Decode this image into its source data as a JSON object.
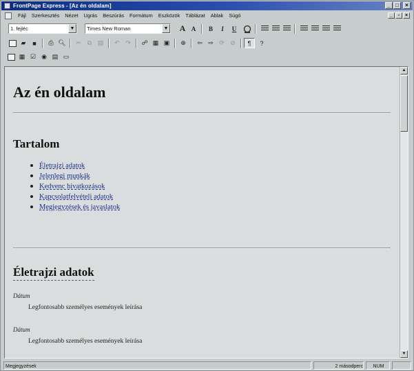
{
  "window": {
    "title": "FrontPage Express - [Az én oldalam]"
  },
  "menu": [
    "Fájl",
    "Szerkesztés",
    "Nézet",
    "Ugrás",
    "Beszúrás",
    "Formátum",
    "Eszközök",
    "Táblázat",
    "Ablak",
    "Súgó"
  ],
  "format_toolbar": {
    "style_value": "1. fejléc",
    "font_value": "Times New Roman",
    "grow_font": "A",
    "shrink_font": "A",
    "bold": "B",
    "italic": "I",
    "underline": "U"
  },
  "standard_toolbar": {
    "show_formatting": "¶",
    "help": "?"
  },
  "document": {
    "heading": "Az én oldalam",
    "toc_heading": "Tartalom",
    "toc_links": [
      "Életrajzi adatok",
      "Jelenlegi munkák",
      "Kedvenc hivatkozások",
      "Kapcsolatfelvételi adatok",
      "Megjegyzések és javaslatok"
    ],
    "bio_heading": "Életrajzi adatok",
    "entries": [
      {
        "term": "Dátum",
        "desc": "Legfontosabb személyes események leírása"
      },
      {
        "term": "Dátum",
        "desc": "Legfontosabb személyes események leírása"
      }
    ]
  },
  "status": {
    "message": "Megjegyzések",
    "time": "2 másodperc",
    "num": "NUM"
  },
  "colors": {
    "title_bar": "#0b2b86",
    "link": "#1d2f8a",
    "chrome": "#c7cdcc"
  },
  "icons": [
    "new-page-icon",
    "open-icon",
    "save-icon",
    "print-icon",
    "print-preview-icon",
    "cut-icon",
    "copy-icon",
    "paste-icon",
    "undo-icon",
    "redo-icon",
    "web-bot-icon",
    "table-icon",
    "image-icon",
    "hyperlink-icon",
    "back-icon",
    "forward-icon",
    "refresh-icon",
    "stop-icon",
    "show-all-icon",
    "help-icon"
  ]
}
